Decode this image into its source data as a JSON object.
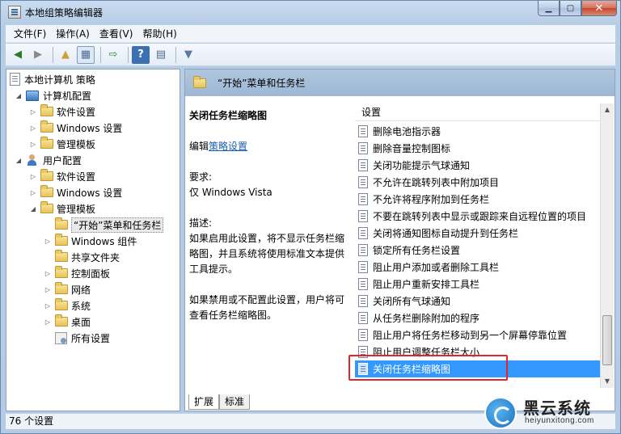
{
  "window": {
    "title": "本地组策略编辑器"
  },
  "menu": [
    "文件(F)",
    "操作(A)",
    "查看(V)",
    "帮助(H)"
  ],
  "toolbar": [
    "back-icon",
    "forward-icon",
    "up-folder-icon",
    "show-hide-tree-icon",
    "export-icon",
    "help-icon",
    "properties-icon",
    "filter-icon"
  ],
  "tree": {
    "root": "本地计算机 策略",
    "computer_config": "计算机配置",
    "software_settings_1": "软件设置",
    "windows_settings_1": "Windows 设置",
    "admin_templates_1": "管理模板",
    "user_config": "用户配置",
    "software_settings_2": "软件设置",
    "windows_settings_2": "Windows 设置",
    "admin_templates_2": "管理模板",
    "start_taskbar": "“开始”菜单和任务栏",
    "windows_components": "Windows 组件",
    "shared_folders": "共享文件夹",
    "control_panel": "控制面板",
    "network": "网络",
    "system": "系统",
    "desktop": "桌面",
    "all_settings": "所有设置"
  },
  "right": {
    "header_title": "“开始”菜单和任务栏",
    "policy_title": "关闭任务栏缩略图",
    "edit_prefix": "编辑",
    "edit_link": "策略设置",
    "requirement_label": "要求:",
    "requirement_value": "仅 Windows Vista",
    "description_label": "描述:",
    "description_1": "如果启用此设置，将不显示任务栏缩略图，并且系统将使用标准文本提供工具提示。",
    "description_2": "如果禁用或不配置此设置，用户将可查看任务栏缩略图。",
    "list_header": "设置",
    "items": [
      "删除电池指示器",
      "删除音量控制图标",
      "关闭功能提示气球通知",
      "不允许在跳转列表中附加项目",
      "不允许将程序附加到任务栏",
      "不要在跳转列表中显示或跟踪来自远程位置的项目",
      "关闭将通知图标自动提升到任务栏",
      "锁定所有任务栏设置",
      "阻止用户添加或者删除工具栏",
      "阻止用户重新安排工具栏",
      "关闭所有气球通知",
      "从任务栏删除附加的程序",
      "阻止用户将任务栏移动到另一个屏幕停靠位置",
      "阻止用户调整任务栏大小",
      "关闭任务栏缩略图"
    ],
    "tabs": [
      "扩展",
      "标准"
    ]
  },
  "status": {
    "text": "76 个设置"
  },
  "watermark": {
    "brand": "黑云系统",
    "url": "heiyunxitong.com"
  }
}
